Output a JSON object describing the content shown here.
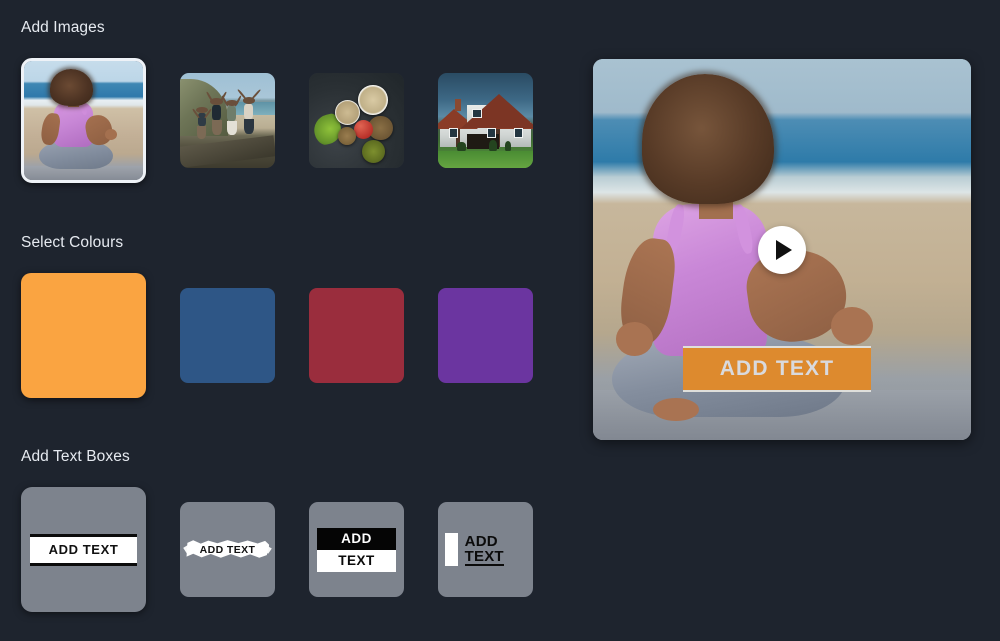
{
  "theme": {
    "background": "#1e242e",
    "section_title_color": "#e6eaf0",
    "selected_border": "#eef2f7",
    "tile_bg": "#7d838d"
  },
  "sections": {
    "images": {
      "title": "Add Images",
      "items": [
        {
          "name": "woman-meditating-on-beach",
          "selected": true
        },
        {
          "name": "friends-jumping-on-dune",
          "selected": false
        },
        {
          "name": "healthy-food-flatlay",
          "selected": false
        },
        {
          "name": "suburban-house-exterior",
          "selected": false
        }
      ]
    },
    "colours": {
      "title": "Select Colours",
      "items": [
        {
          "name": "orange",
          "hex": "#faa441",
          "selected": true
        },
        {
          "name": "blue",
          "hex": "#2e5686",
          "selected": false
        },
        {
          "name": "red",
          "hex": "#9a2d3d",
          "selected": false
        },
        {
          "name": "purple",
          "hex": "#6b35a0",
          "selected": false
        }
      ]
    },
    "textboxes": {
      "title": "Add Text Boxes",
      "items": [
        {
          "name": "ruled-bar",
          "label": "ADD TEXT",
          "selected": true
        },
        {
          "name": "brush-stroke",
          "label": "ADD TEXT",
          "selected": false
        },
        {
          "name": "split-block",
          "label_top": "ADD",
          "label_bottom": "TEXT",
          "selected": false
        },
        {
          "name": "bar-underline",
          "label_top": "ADD",
          "label_bottom": "TEXT",
          "selected": false
        }
      ]
    }
  },
  "preview": {
    "name": "video-preview",
    "play_icon": "play-icon",
    "overlay_text": "ADD TEXT",
    "overlay_fill": "#dd8a2e",
    "overlay_frame": "#dfdfdb",
    "overlay_text_color": "#d9dade"
  }
}
